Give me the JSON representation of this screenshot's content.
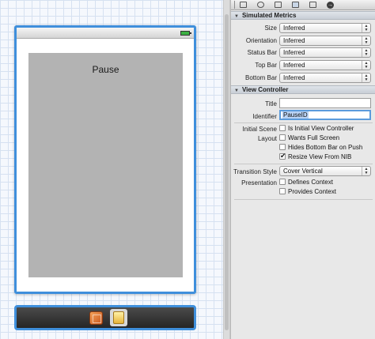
{
  "canvas": {
    "view_controller": {
      "label": "Pause"
    },
    "scene_dock": {
      "icons": [
        "first-responder-cube-icon",
        "view-controller-icon"
      ]
    }
  },
  "inspector": {
    "tabs": [
      "file-inspector-icon",
      "quick-help-icon",
      "identity-inspector-icon",
      "attributes-inspector-icon",
      "size-inspector-icon",
      "connections-inspector-icon"
    ],
    "simulated_metrics": {
      "title": "Simulated Metrics",
      "rows": [
        {
          "label": "Size",
          "value": "Inferred"
        },
        {
          "label": "Orientation",
          "value": "Inferred"
        },
        {
          "label": "Status Bar",
          "value": "Inferred"
        },
        {
          "label": "Top Bar",
          "value": "Inferred"
        },
        {
          "label": "Bottom Bar",
          "value": "Inferred"
        }
      ]
    },
    "view_controller": {
      "title": "View Controller",
      "title_label": "Title",
      "title_value": "",
      "identifier_label": "Identifier",
      "identifier_value": "PauseID",
      "initial_scene_label": "Initial Scene",
      "is_initial_label": "Is Initial View Controller",
      "is_initial_checked": false,
      "layout_label": "Layout",
      "wants_full_screen_label": "Wants Full Screen",
      "wants_full_screen_checked": false,
      "hides_bottom_bar_label": "Hides Bottom Bar on Push",
      "hides_bottom_bar_checked": false,
      "resize_from_nib_label": "Resize View From NIB",
      "resize_from_nib_checked": true,
      "transition_style_label": "Transition Style",
      "transition_style_value": "Cover Vertical",
      "presentation_label": "Presentation",
      "defines_context_label": "Defines Context",
      "defines_context_checked": false,
      "provides_context_label": "Provides Context",
      "provides_context_checked": false
    }
  },
  "colors": {
    "selection_blue": "#3f8fdc",
    "grid_line": "#d6e1f1",
    "view_gray": "#b3b3b3"
  }
}
